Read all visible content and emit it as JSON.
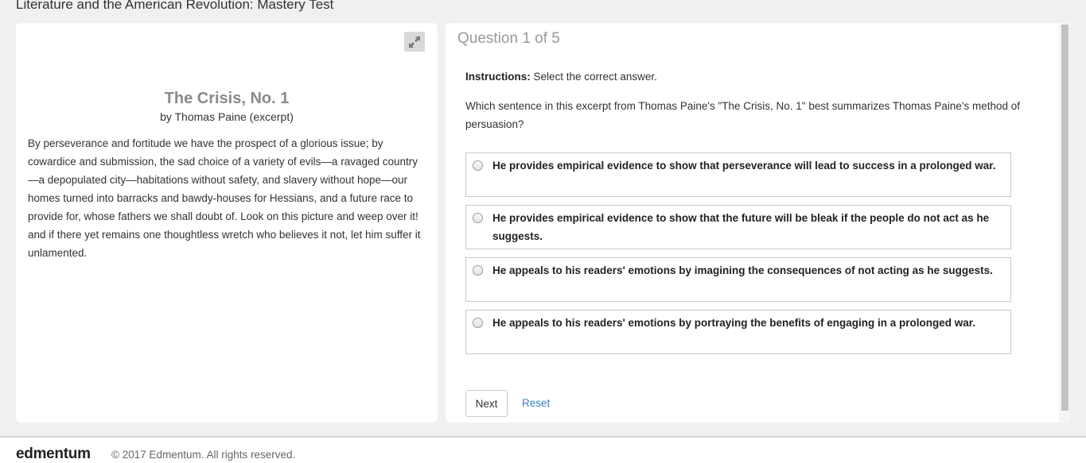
{
  "page": {
    "title": "Literature and the American Revolution: Mastery Test"
  },
  "passage": {
    "title": "The Crisis, No. 1",
    "byline": "by Thomas Paine (excerpt)",
    "text": "By perseverance and fortitude we have the prospect of a glorious issue; by cowardice and submission, the sad choice of a variety of evils—a ravaged country—a depopulated city—habitations without safety, and slavery without hope—our homes turned into barracks and bawdy-houses for Hessians, and a future race to provide for, whose fathers we shall doubt of. Look on this picture and weep over it! and if there yet remains one thoughtless wretch who believes it not, let him suffer it unlamented.",
    "expand_icon": "expand-arrows-icon"
  },
  "question": {
    "header": "Question 1 of 5",
    "instructions_label": "Instructions:",
    "instructions_text": " Select the correct answer.",
    "prompt": "Which sentence in this excerpt from Thomas Paine's \"The Crisis, No. 1\" best summarizes Thomas Paine's method of persuasion?",
    "choices": [
      "He provides empirical evidence to show that perseverance will lead to success in a prolonged war.",
      "He provides empirical evidence to show that the future will be bleak if the people do not act as he suggests.",
      "He appeals to his readers' emotions by imagining the consequences of not acting as he suggests.",
      "He appeals to his readers' emotions by portraying the benefits of engaging in a prolonged war."
    ],
    "selected": null
  },
  "actions": {
    "next_label": "Next",
    "reset_label": "Reset"
  },
  "footer": {
    "logo": "edmentum",
    "copyright": "© 2017 Edmentum. All rights reserved."
  },
  "colors": {
    "link": "#3a7fbf",
    "background": "#f0f0f0",
    "panel": "#ffffff"
  }
}
